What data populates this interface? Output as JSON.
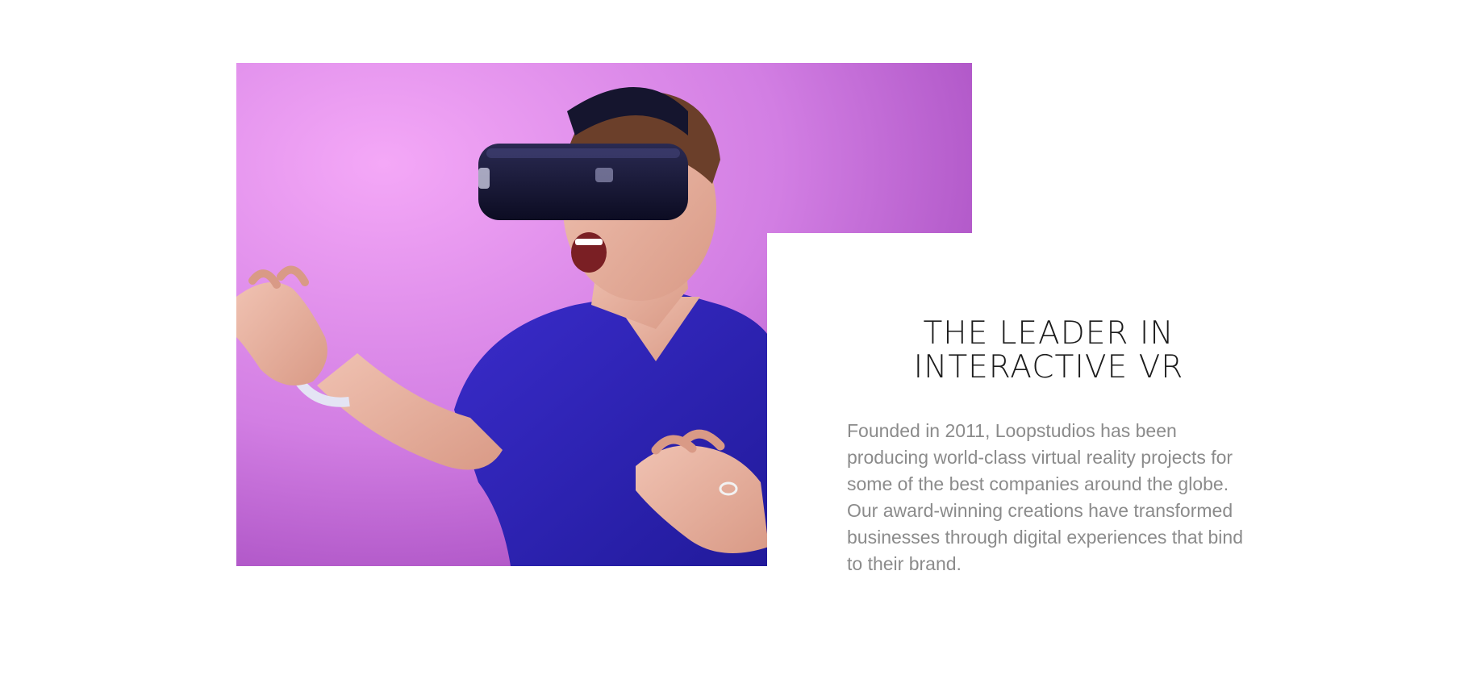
{
  "about": {
    "headline_line1": "THE LEADER IN",
    "headline_line2": "INTERACTIVE VR",
    "body": "Founded in 2011, Loopstudios has been producing world-class virtual reality projects for some of the best companies around the globe. Our award-winning creations have transformed businesses through digital experiences that bind to their brand."
  },
  "colors": {
    "background": "#ffffff",
    "headline": "#1c1c1c",
    "body_text": "#8b8b8b",
    "photo_backdrop": "#d980e6"
  },
  "image": {
    "subject": "man-wearing-vr-headset-photo"
  }
}
